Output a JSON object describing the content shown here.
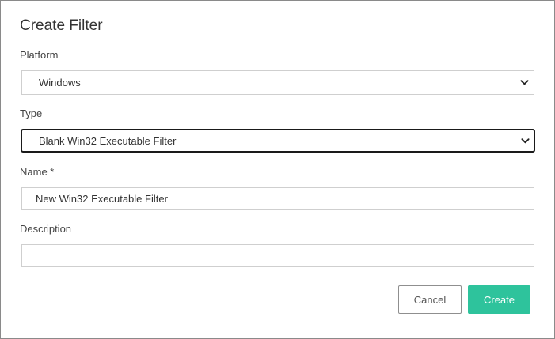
{
  "dialog": {
    "title": "Create Filter",
    "platform": {
      "label": "Platform",
      "selected": "Windows"
    },
    "type": {
      "label": "Type",
      "selected": "Blank Win32 Executable Filter"
    },
    "name": {
      "label": "Name *",
      "value": "New Win32 Executable Filter"
    },
    "description": {
      "label": "Description",
      "value": ""
    },
    "buttons": {
      "cancel": "Cancel",
      "create": "Create"
    }
  },
  "colors": {
    "accent": "#2ec39c",
    "border": "#cfcfcf",
    "focus_border": "#1a1a1a"
  },
  "icons": {
    "select_arrow": "chevron-down-icon"
  }
}
